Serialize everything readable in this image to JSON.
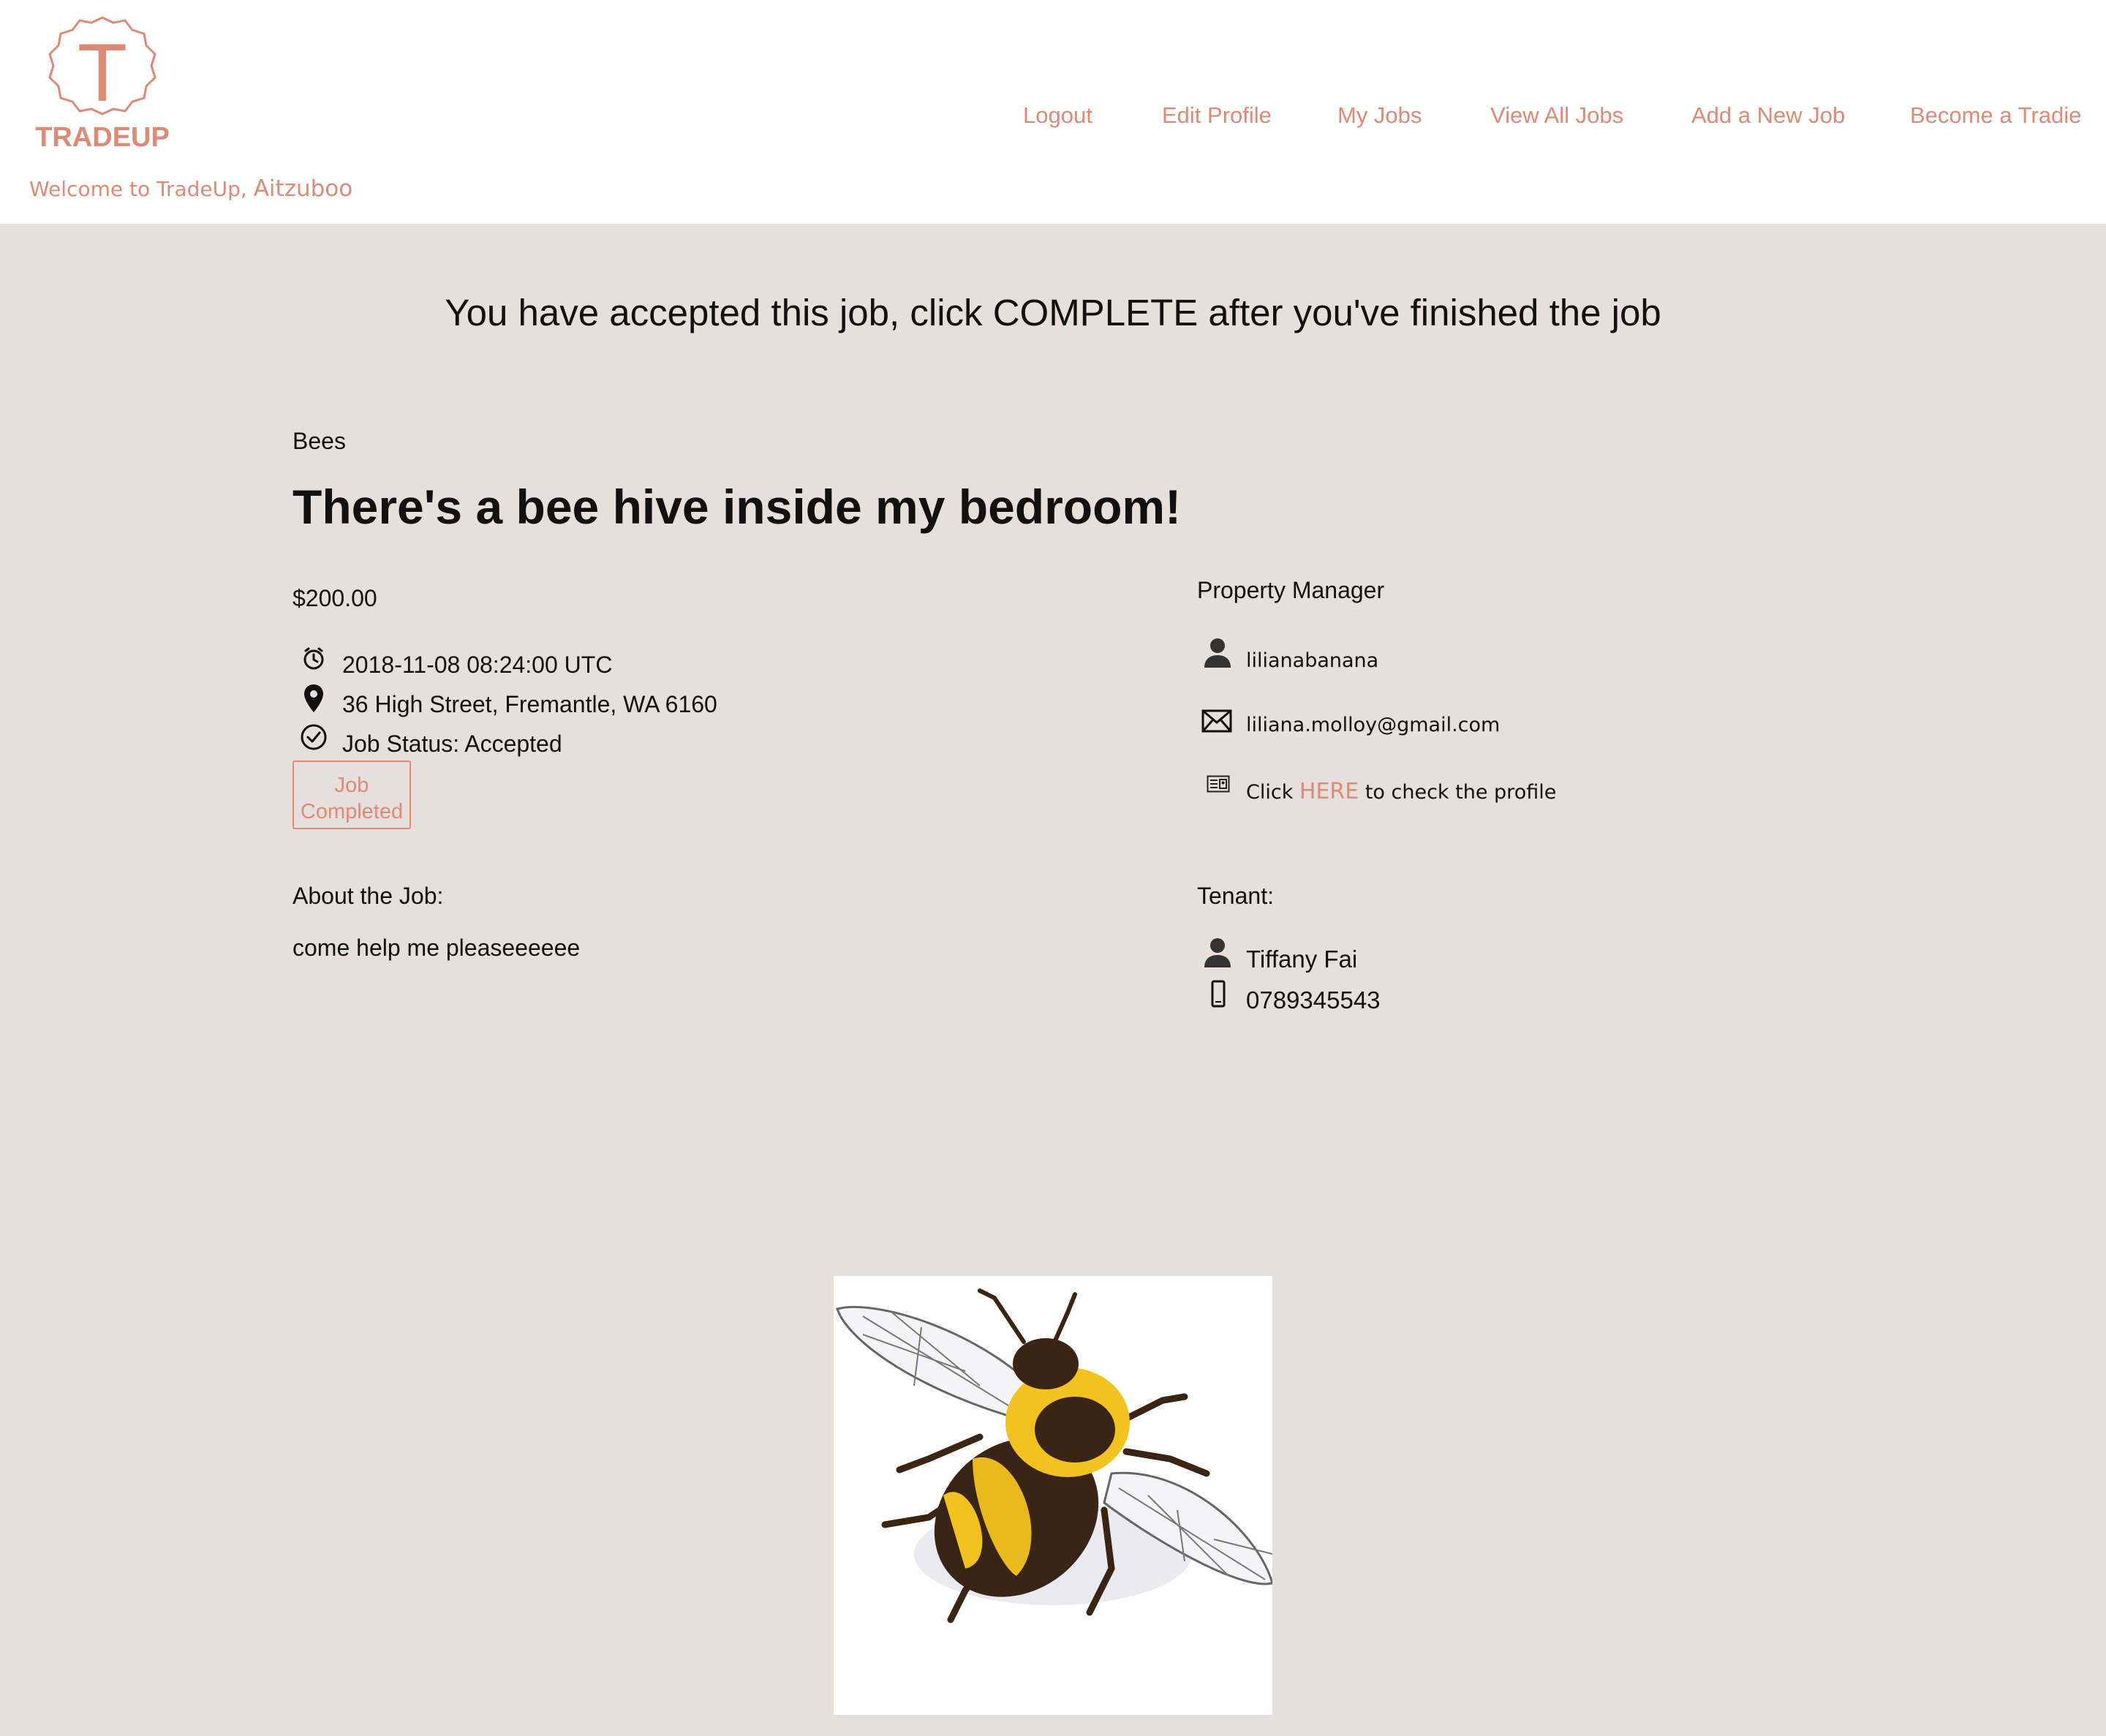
{
  "header": {
    "brand": "TRADEUP",
    "brand_letter": "T",
    "welcome_prefix": "Welcome to TradeUp, ",
    "username": "Aitzuboo",
    "nav": {
      "logout": "Logout",
      "edit_profile": "Edit Profile",
      "my_jobs": "My Jobs",
      "view_all_jobs": "View All Jobs",
      "add_new_job": "Add a New Job",
      "become_tradie": "Become a Tradie"
    }
  },
  "banner": "You have accepted this job, click COMPLETE after you've finished the job",
  "job": {
    "category": "Bees",
    "title": "There's a bee hive inside my bedroom!",
    "price": "$200.00",
    "datetime": "2018-11-08 08:24:00 UTC",
    "address": "36 High Street, Fremantle, WA 6160",
    "status": "Job Status: Accepted",
    "complete_button": "Job Completed",
    "about_label": "About the Job:",
    "description": "come help me pleaseeeeee"
  },
  "property_manager": {
    "label": "Property Manager",
    "username": "lilianabanana",
    "email": "liliana.molloy@gmail.com",
    "profile_prefix": "Click ",
    "profile_link": "HERE",
    "profile_suffix": " to check the profile"
  },
  "tenant": {
    "label": "Tenant:",
    "name": "Tiffany Fai",
    "phone": "0789345543"
  },
  "colors": {
    "accent": "#dc8b79",
    "page_background": "#e7dede",
    "header_background": "#ffffff",
    "bee_yellow": "#f3c21e",
    "bee_dark": "#3a2414"
  },
  "icons": {
    "clock": "clock-icon",
    "location": "map-pin-icon",
    "status": "check-circle-icon",
    "user": "user-icon",
    "email": "envelope-icon",
    "profile": "id-card-icon",
    "phone": "mobile-phone-icon"
  }
}
